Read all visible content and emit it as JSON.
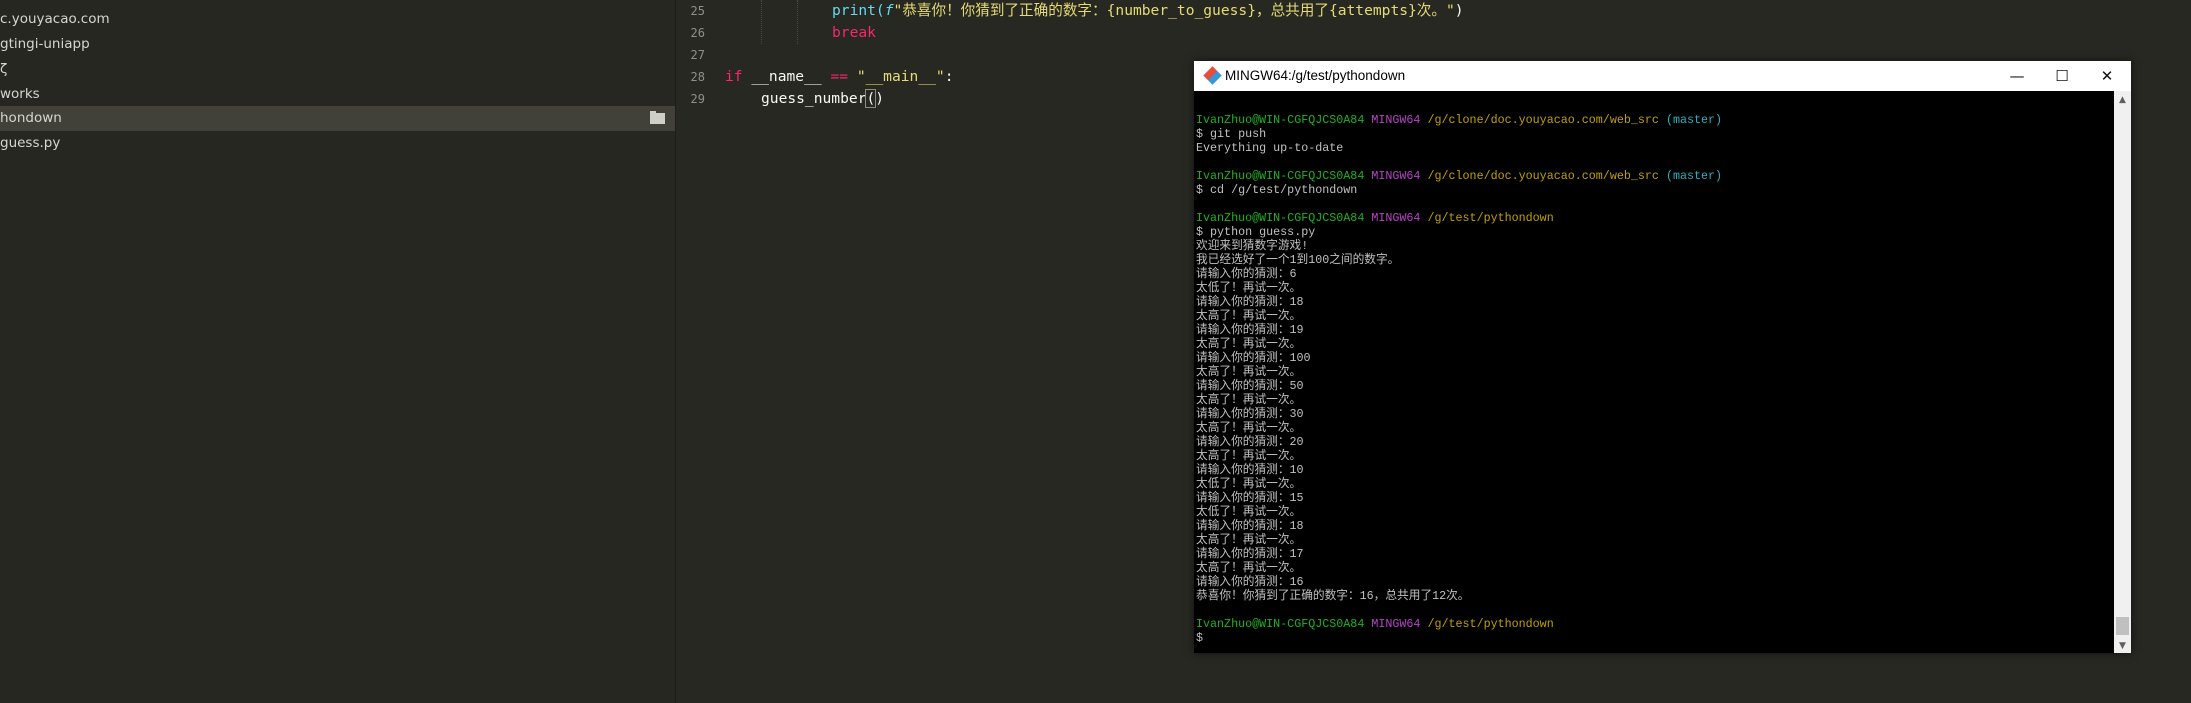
{
  "sidebar": {
    "items": [
      {
        "label": "c.youyacao.com"
      },
      {
        "label": "gtingi-uniapp"
      },
      {
        "label": "ζ"
      },
      {
        "label": "works"
      },
      {
        "label": "hondown",
        "selected": true,
        "icon": "folder-icon"
      },
      {
        "label": " guess.py"
      }
    ]
  },
  "editor": {
    "line_numbers": [
      "25",
      "26",
      "27",
      "28",
      "29"
    ],
    "code": {
      "l25_print": "print(",
      "l25_f": "f",
      "l25_str": "\"恭喜你！你猜到了正确的数字：{number_to_guess}，总共用了{attempts}次。\"",
      "l25_close": ")",
      "l26_break": "break",
      "l28_if": "if",
      "l28_name": " __name__ ",
      "l28_eq": "==",
      "l28_main": " \"__main__\"",
      "l28_colon": ":",
      "l29_call": "guess_number",
      "l29_open": "(",
      "l29_close": ")"
    }
  },
  "terminal": {
    "title": "MINGW64:/g/test/pythondown",
    "controls": {
      "minimize": "—",
      "maximize": "☐",
      "close": "✕"
    },
    "prompt_user": "IvanZhuo@WIN-CGFQJCS0A84",
    "prompt_env": "MINGW64",
    "path1": "/g/clone/doc.youyacao.com/web_src",
    "branch": "(master)",
    "path2": "/g/test/pythondown",
    "cmd_push": "$ git push",
    "out_push": "Everything up-to-date",
    "cmd_cd": "$ cd /g/test/pythondown",
    "cmd_python": "$ python guess.py",
    "welcome": "欢迎来到猜数字游戏!",
    "chosen": "我已经选好了一个1到100之间的数字。",
    "guesses": [
      {
        "input": "请输入你的猜测：6",
        "result": "太低了！再试一次。"
      },
      {
        "input": "请输入你的猜测：18",
        "result": "太高了！再试一次。"
      },
      {
        "input": "请输入你的猜测：19",
        "result": "太高了！再试一次。"
      },
      {
        "input": "请输入你的猜测：100",
        "result": "太高了！再试一次。"
      },
      {
        "input": "请输入你的猜测：50",
        "result": "太高了！再试一次。"
      },
      {
        "input": "请输入你的猜测：30",
        "result": "太高了！再试一次。"
      },
      {
        "input": "请输入你的猜测：20",
        "result": "太高了！再试一次。"
      },
      {
        "input": "请输入你的猜测：10",
        "result": "太低了！再试一次。"
      },
      {
        "input": "请输入你的猜测：15",
        "result": "太低了！再试一次。"
      },
      {
        "input": "请输入你的猜测：18",
        "result": "太高了！再试一次。"
      },
      {
        "input": "请输入你的猜测：17",
        "result": "太高了！再试一次。"
      }
    ],
    "final_input": "请输入你的猜测：16",
    "congrats": "恭喜你！你猜到了正确的数字：16，总共用了12次。",
    "final_prompt": "$"
  }
}
